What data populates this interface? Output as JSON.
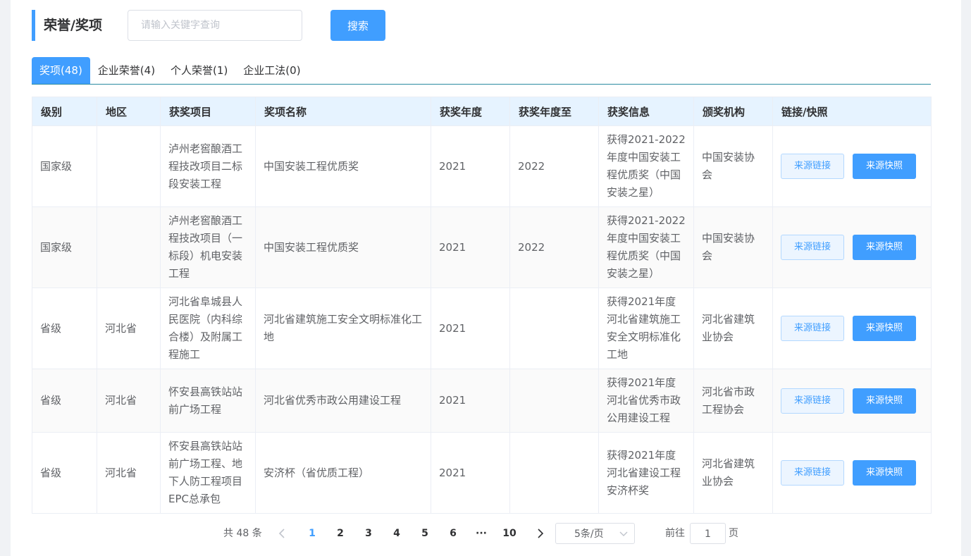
{
  "header": {
    "title": "荣誉/奖项",
    "search_placeholder": "请输入关键字查询",
    "search_button": "搜索"
  },
  "tabs": [
    {
      "label": "奖项(48)",
      "active": true
    },
    {
      "label": "企业荣誉(4)",
      "active": false
    },
    {
      "label": "个人荣誉(1)",
      "active": false
    },
    {
      "label": "企业工法(0)",
      "active": false
    }
  ],
  "table": {
    "columns": [
      "级别",
      "地区",
      "获奖项目",
      "奖项名称",
      "获奖年度",
      "获奖年度至",
      "获奖信息",
      "颁奖机构",
      "链接/快照"
    ],
    "rows": [
      {
        "level": "国家级",
        "region": "",
        "project": "泸州老窖酿酒工程技改项目二标段安装工程",
        "award": "中国安装工程优质奖",
        "year": "2021",
        "year_to": "2022",
        "info": "获得2021-2022年度中国安装工程优质奖（中国安装之星）",
        "org": "中国安装协会",
        "link_label": "来源链接",
        "snapshot_label": "来源快照"
      },
      {
        "level": "国家级",
        "region": "",
        "project": "泸州老窖酿酒工程技改项目（一标段）机电安装工程",
        "award": "中国安装工程优质奖",
        "year": "2021",
        "year_to": "2022",
        "info": "获得2021-2022年度中国安装工程优质奖（中国安装之星）",
        "org": "中国安装协会",
        "link_label": "来源链接",
        "snapshot_label": "来源快照"
      },
      {
        "level": "省级",
        "region": "河北省",
        "project": "河北省阜城县人民医院（内科综合楼）及附属工程施工",
        "award": "河北省建筑施工安全文明标准化工地",
        "year": "2021",
        "year_to": "",
        "info": "获得2021年度河北省建筑施工安全文明标准化工地",
        "org": "河北省建筑业协会",
        "link_label": "来源链接",
        "snapshot_label": "来源快照"
      },
      {
        "level": "省级",
        "region": "河北省",
        "project": "怀安县高铁站站前广场工程",
        "award": "河北省优秀市政公用建设工程",
        "year": "2021",
        "year_to": "",
        "info": "获得2021年度河北省优秀市政公用建设工程",
        "org": "河北省市政工程协会",
        "link_label": "来源链接",
        "snapshot_label": "来源快照"
      },
      {
        "level": "省级",
        "region": "河北省",
        "project": "怀安县高铁站站前广场工程、地下人防工程项目EPC总承包",
        "award": "安济杯（省优质工程）",
        "year": "2021",
        "year_to": "",
        "info": "获得2021年度河北省建设工程安济杯奖",
        "org": "河北省建筑业协会",
        "link_label": "来源链接",
        "snapshot_label": "来源快照"
      }
    ]
  },
  "pagination": {
    "total": "共 48 条",
    "pages": [
      "1",
      "2",
      "3",
      "4",
      "5",
      "6",
      "···",
      "10"
    ],
    "current": "1",
    "page_size": "5条/页",
    "goto_label": "前往",
    "goto_value": "1",
    "page_suffix": "页"
  }
}
